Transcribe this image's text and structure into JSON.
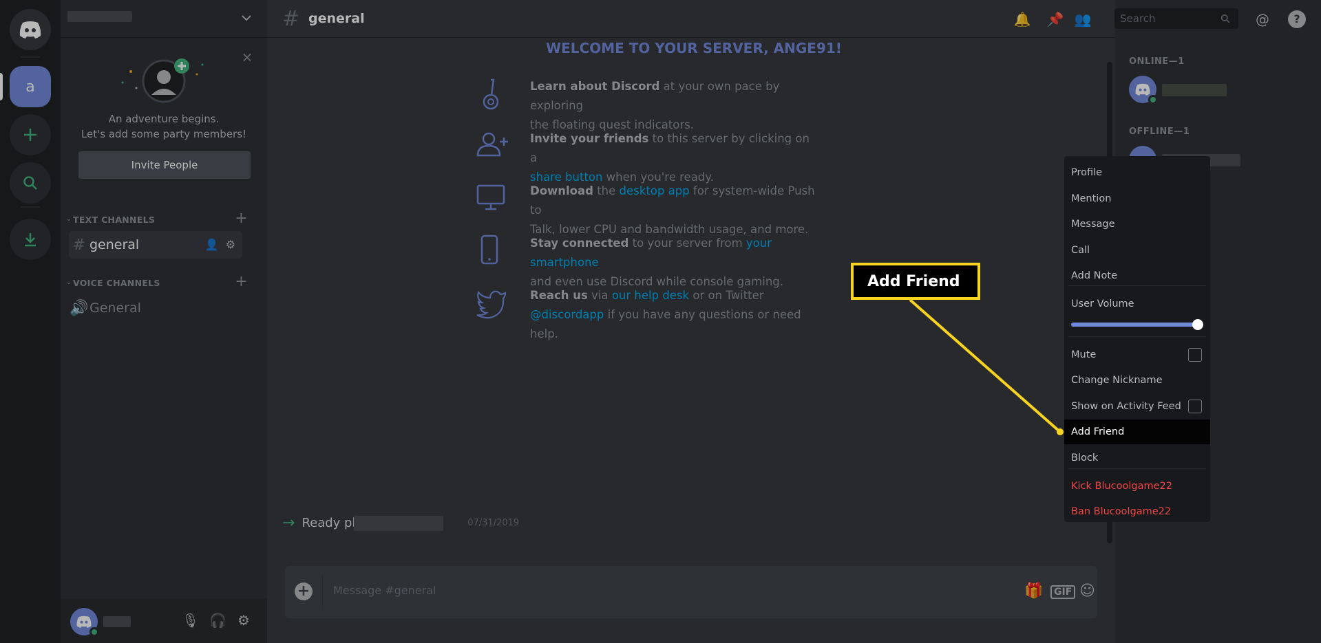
{
  "colors": {
    "accent": "#7289da",
    "online": "#43b581",
    "danger": "#f04747",
    "link": "#00b0f4",
    "callout": "#f8d31f"
  },
  "guilds": {
    "home_icon": "discord-logo-icon",
    "active_server_letter": "a",
    "add_icon": "plus-icon",
    "search_icon": "search-icon",
    "download_icon": "download-icon"
  },
  "sidebar": {
    "invite": {
      "line1": "An adventure begins.",
      "line2": "Let's add some party members!",
      "button": "Invite People"
    },
    "text_category": "TEXT CHANNELS",
    "voice_category": "VOICE CHANNELS",
    "text_channels": [
      {
        "name": "general"
      }
    ],
    "voice_channels": [
      {
        "name": "General"
      }
    ]
  },
  "header": {
    "channel": "general",
    "search_placeholder": "Search"
  },
  "welcome": {
    "title": "WELCOME TO YOUR SERVER, ANGE91!",
    "items": [
      {
        "bold": "Learn about Discord",
        "rest1": " at your own pace by exploring",
        "line2": "the floating quest indicators."
      },
      {
        "bold": "Invite your friends",
        "rest1": " to this server by clicking on a",
        "link": "share button",
        "line2": " when you're ready."
      },
      {
        "bold": "Download",
        "pre_link": " the ",
        "link": "desktop app",
        "rest1": " for system-wide Push to",
        "line2": "Talk, lower CPU and bandwidth usage, and more."
      },
      {
        "bold": "Stay connected",
        "pre_link": " to your server from ",
        "link": "your smartphone",
        "line2": "and even use Discord while console gaming."
      },
      {
        "bold": "Reach us",
        "pre_link": " via ",
        "link": "our help desk",
        "rest1": " or on Twitter",
        "link2": "@discordapp",
        "line2": " if you have any questions or need help."
      }
    ]
  },
  "message": {
    "text": "Ready playe",
    "timestamp": "07/31/2019"
  },
  "composer": {
    "placeholder": "Message #general"
  },
  "members": {
    "online_label": "ONLINE—1",
    "offline_label": "OFFLINE—1"
  },
  "context_menu": {
    "items": [
      "Profile",
      "Mention",
      "Message",
      "Call",
      "Add Note",
      "User Volume",
      "Mute",
      "Change Nickname",
      "Show on Activity Feed",
      "Add Friend",
      "Block",
      "Kick Blucoolgame22",
      "Ban Blucoolgame22"
    ],
    "volume_level": 1.0
  },
  "callout": {
    "label": "Add Friend"
  }
}
